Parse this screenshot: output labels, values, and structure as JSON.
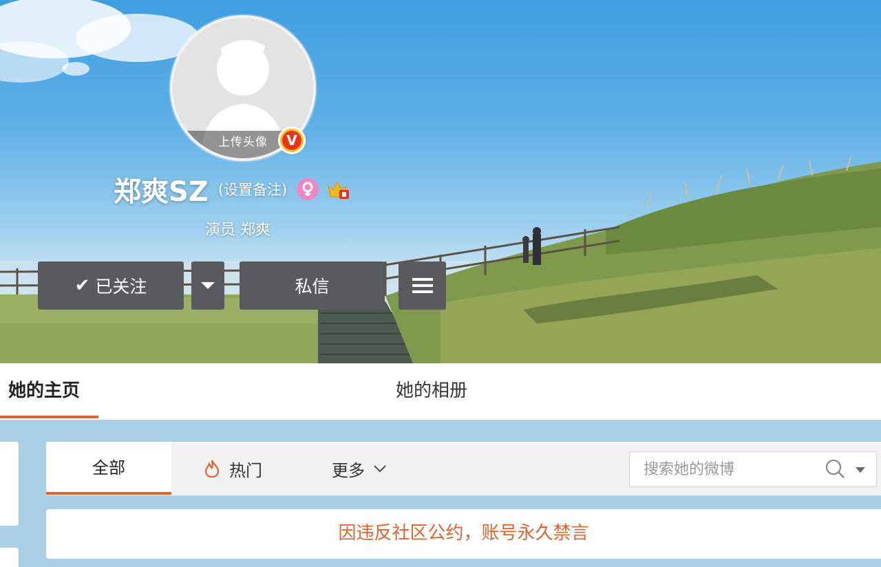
{
  "profile": {
    "avatar_upload_label": "上传头像",
    "verified_badge": "V",
    "name": "郑爽SZ",
    "remark_label": "(设置备注)",
    "gender_icon": "female-icon",
    "vip_icon": "vip-crown-icon",
    "occupation": "演员 郑爽"
  },
  "actions": {
    "follow_label": "已关注",
    "message_label": "私信"
  },
  "tabs": {
    "home": "她的主页",
    "album": "她的相册"
  },
  "filter": {
    "all": "全部",
    "hot": "热门",
    "more": "更多",
    "search_placeholder": "搜索她的微博"
  },
  "notice": "因违反社区公约，账号永久禁言",
  "colors": {
    "accent": "#e0632c",
    "button_bg": "#595a5e",
    "verified_red": "#e8341c",
    "verified_gold": "#f3c01d",
    "female_pink": "#ef87c2"
  }
}
